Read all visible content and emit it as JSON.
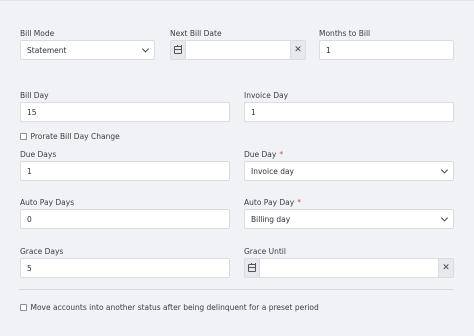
{
  "bill_mode": {
    "label": "Bill Mode",
    "value": "Statement"
  },
  "next_bill_date": {
    "label": "Next Bill Date",
    "value": ""
  },
  "months_to_bill": {
    "label": "Months to Bill",
    "value": "1"
  },
  "bill_day": {
    "label": "Bill Day",
    "value": "15"
  },
  "invoice_day": {
    "label": "Invoice Day",
    "value": "1"
  },
  "prorate": {
    "label": "Prorate Bill Day Change",
    "checked": false
  },
  "due_days": {
    "label": "Due Days",
    "value": "1"
  },
  "due_day": {
    "label": "Due Day",
    "value": "Invoice day",
    "required_mark": "*"
  },
  "auto_pay_days": {
    "label": "Auto Pay Days",
    "value": "0"
  },
  "auto_pay_day": {
    "label": "Auto Pay Day",
    "value": "Billing day",
    "required_mark": "*"
  },
  "grace_days": {
    "label": "Grace Days",
    "value": "5"
  },
  "grace_until": {
    "label": "Grace Until",
    "value": ""
  },
  "move_accounts": {
    "label": "Move accounts into another status after being delinquent for a preset period",
    "checked": false
  },
  "icons": {
    "calendar": "calendar-icon",
    "clear": "close-icon",
    "chevron": "chevron-down-icon"
  },
  "colors": {
    "background": "#f1f2f5",
    "field_border": "#d9dce1",
    "required": "#d04a4a"
  }
}
